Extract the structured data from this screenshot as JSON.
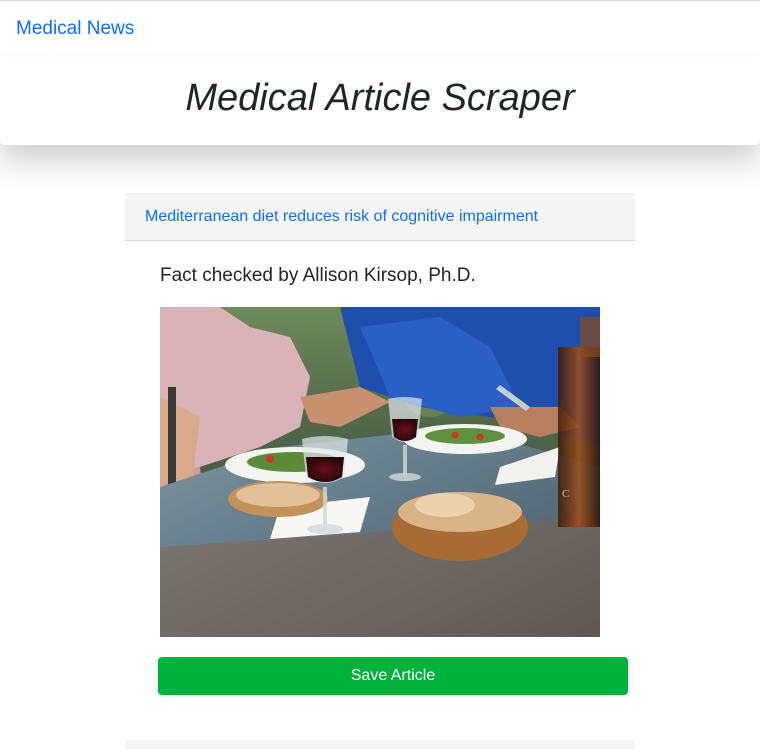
{
  "navbar": {
    "brand": "Medical News"
  },
  "header": {
    "title": "Medical Article Scraper"
  },
  "articles": [
    {
      "title": "Mediterranean diet reduces risk of cognitive impairment",
      "fact_checker": "Fact checked by Allison Kirsop, Ph.D.",
      "save_label": "Save Article"
    }
  ],
  "colors": {
    "link": "#0d6efd",
    "save_button": "#00b33c",
    "card_header_bg": "#f5f5f5"
  }
}
